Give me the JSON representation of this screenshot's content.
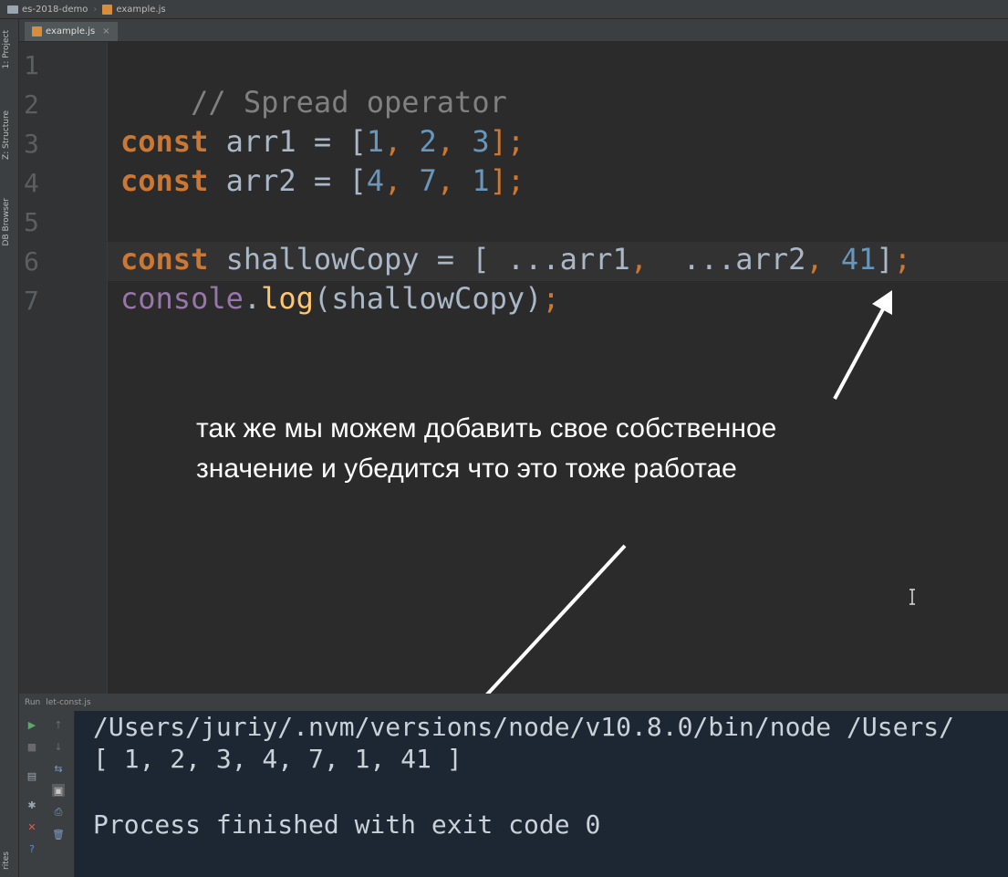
{
  "navbar": {
    "project": "es-2018-demo",
    "file": "example.js"
  },
  "tool_strip": {
    "project_label": "1: Project",
    "structure_label": "Z: Structure",
    "db_label": "DB Browser",
    "favorites_label": "rites"
  },
  "editor_tab": {
    "label": "example.js",
    "close": "×"
  },
  "line_numbers": [
    "1",
    "2",
    "3",
    "4",
    "5",
    "6",
    "7"
  ],
  "code": {
    "line1": "// Spread operator",
    "line3": {
      "kw": "const",
      "name": " arr1 = [",
      "n1": "1",
      "c1": ", ",
      "n2": "2",
      "c2": ", ",
      "n3": "3",
      "end": "];"
    },
    "line4": {
      "kw": "const",
      "name": " arr2 = [",
      "n1": "4",
      "c1": ", ",
      "n2": "7",
      "c2": ", ",
      "n3": "1",
      "end": "];"
    },
    "line6": {
      "kw": "const",
      "name": " shallowCopy = [ ...arr1",
      "c1": ",  ",
      "spread2": "...arr2",
      "c2": ", ",
      "n": "41",
      "end": "];"
    },
    "line7": {
      "obj": "console",
      "dot": ".",
      "fn": "log",
      "rest": "(shallowCopy)",
      "end": ";"
    }
  },
  "annotation": {
    "line1": "так же мы можем добавить свое собственное",
    "line2": "значение и убедится что это тоже работае"
  },
  "run_panel": {
    "label": "Run",
    "config": "let-const.js"
  },
  "console": {
    "line1": "/Users/juriy/.nvm/versions/node/v10.8.0/bin/node /Users/",
    "line2": "[ 1, 2, 3, 4, 7, 1, 41 ]",
    "line3": "Process finished with exit code 0"
  },
  "colors": {
    "keyword": "#cc7832",
    "number": "#6897bb",
    "comment": "#808080",
    "function": "#ffc66d",
    "console_bg": "#1d2733"
  }
}
